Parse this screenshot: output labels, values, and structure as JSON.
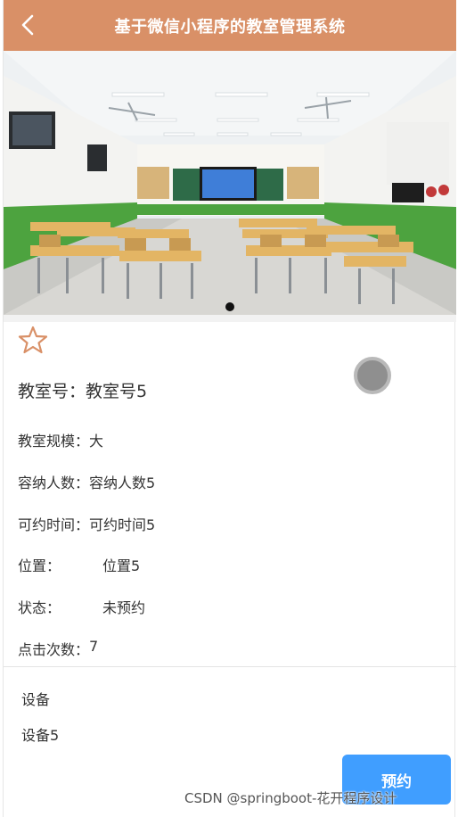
{
  "header": {
    "title": "基于微信小程序的教室管理系统",
    "back_icon": "chevron-left-icon",
    "bg_color": "#d99067"
  },
  "banner": {
    "image_desc_icon": "classroom-photo",
    "active_slide": 1,
    "slide_count": 1
  },
  "detail": {
    "favorite_icon": "star-outline-icon",
    "room_label": "教室号：",
    "room_value": "教室号5",
    "rows": [
      {
        "label": "教室规模：",
        "value": "大"
      },
      {
        "label": "容纳人数：",
        "value": "容纳人数5"
      },
      {
        "label": "可约时间：",
        "value": "可约时间5"
      },
      {
        "label": "位置：",
        "value": "位置5"
      },
      {
        "label": "状态：",
        "value": "未预约"
      },
      {
        "label": "点击次数：",
        "value": "7"
      }
    ]
  },
  "equipment": {
    "label": "设备",
    "value": "设备5"
  },
  "actions": {
    "book_label": "预约",
    "book_color": "#409eff"
  },
  "watermark": "CSDN @springboot-花开程序设计"
}
